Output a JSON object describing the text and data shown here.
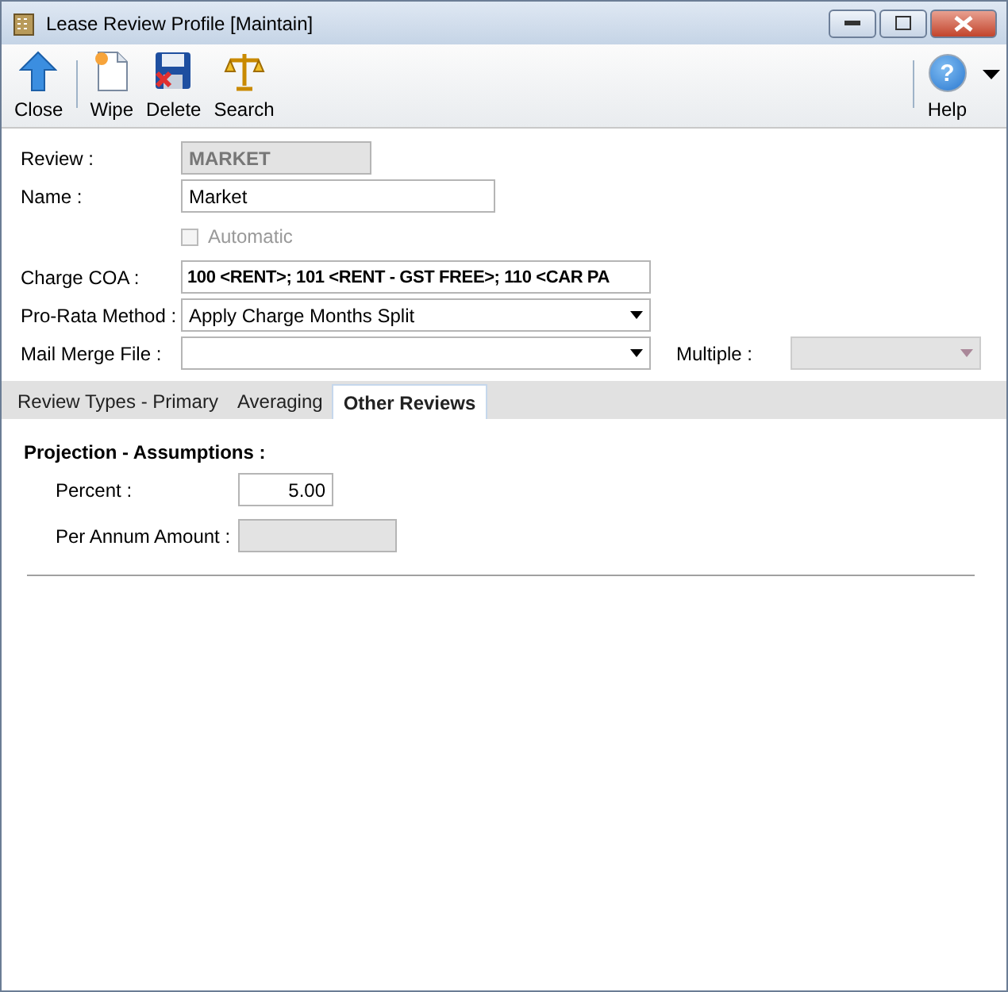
{
  "window": {
    "title": "Lease Review Profile [Maintain]"
  },
  "toolbar": {
    "buttons": [
      {
        "kind": "close",
        "label": "Close"
      },
      {
        "kind": "wipe",
        "label": "Wipe"
      },
      {
        "kind": "delete",
        "label": "Delete"
      },
      {
        "kind": "search",
        "label": "Search"
      }
    ],
    "help": {
      "kind": "help",
      "label": "Help",
      "glyph": "?"
    }
  },
  "form": {
    "review": {
      "label": "Review :",
      "value": "MARKET"
    },
    "name": {
      "label": "Name :",
      "value": "Market"
    },
    "automatic": {
      "label": "Automatic",
      "checked": false,
      "disabled": true
    },
    "charge_coa": {
      "label": "Charge COA :",
      "value": "100 <RENT>; 101 <RENT - GST FREE>; 110 <CAR PA"
    },
    "pro_rata": {
      "label": "Pro-Rata Method :",
      "value": "Apply Charge Months Split"
    },
    "mail_merge": {
      "label": "Mail Merge File :"
    },
    "multiple": {
      "label": "Multiple :",
      "disabled": true
    }
  },
  "tabs": [
    {
      "label": "Review Types - Primary",
      "selected": false
    },
    {
      "label": "Averaging",
      "selected": false
    },
    {
      "label": "Other Reviews",
      "selected": true
    }
  ],
  "other_reviews": {
    "heading": "Projection - Assumptions :",
    "percent": {
      "label": "Percent :",
      "value": "5.00"
    },
    "per_annum": {
      "label": "Per Annum Amount :"
    }
  }
}
